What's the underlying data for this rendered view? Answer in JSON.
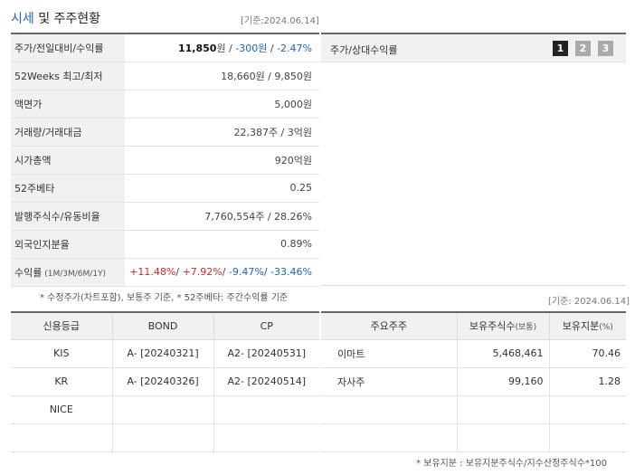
{
  "header": {
    "title_blue": "시세",
    "title_rest": " 및 주주현황",
    "date": "[기준:2024.06.14]"
  },
  "price": {
    "row1": {
      "label": "주가/전일대비/수익률",
      "price": "11,850",
      "price_unit": "원",
      "sep1": " / ",
      "change": "-300원",
      "sep2": " / ",
      "pct": "-2.47%"
    },
    "row2": {
      "label": "52Weeks 최고/최저",
      "value": "18,660원 / 9,850원"
    },
    "row3": {
      "label": "액면가",
      "value": "5,000원"
    },
    "row4": {
      "label": "거래량/거래대금",
      "value": "22,387주 / 3억원"
    },
    "row5": {
      "label": "시가총액",
      "value": "920억원"
    },
    "row6": {
      "label": "52주베타",
      "value": "0.25"
    },
    "row7": {
      "label": "발행주식수/유동비율",
      "value": "7,760,554주 / 28.26%"
    },
    "row8": {
      "label": "외국인지분율",
      "value": "0.89%"
    },
    "row9": {
      "label": "수익률",
      "label_sub": " (1M/3M/6M/1Y)",
      "r1": "+11.48%",
      "s1": "/ ",
      "r2": "+7.92%",
      "s2": "/ ",
      "r3": "-9.47%",
      "s3": "/ ",
      "r4": "-33.46%"
    }
  },
  "note1": "* 수정주가(차트포함), 보통주 기준, * 52주베타: 주간수익률 기준",
  "chart": {
    "title": "주가/상대수익률",
    "pages": [
      "1",
      "2",
      "3"
    ],
    "active_page": "1"
  },
  "date2": "[기준: 2024.06.14]",
  "credit": {
    "headers": [
      "신용등급",
      "BOND",
      "CP"
    ],
    "rows": [
      [
        "KIS",
        "A-  [20240321]",
        "A2-  [20240531]"
      ],
      [
        "KR",
        "A-  [20240326]",
        "A2-  [20240514]"
      ],
      [
        "NICE",
        "",
        ""
      ],
      [
        "",
        "",
        ""
      ]
    ]
  },
  "holders": {
    "headers": [
      "주요주주",
      "보유주식수",
      "(보통)",
      "보유지분",
      "(%)"
    ],
    "rows": [
      [
        "이마트",
        "5,468,461",
        "70.46"
      ],
      [
        "자사주",
        "99,160",
        "1.28"
      ],
      [
        "",
        "",
        ""
      ],
      [
        "",
        "",
        ""
      ]
    ]
  },
  "note2": "* 보유지분 : 보유지분주식수/지수산정주식수*100"
}
